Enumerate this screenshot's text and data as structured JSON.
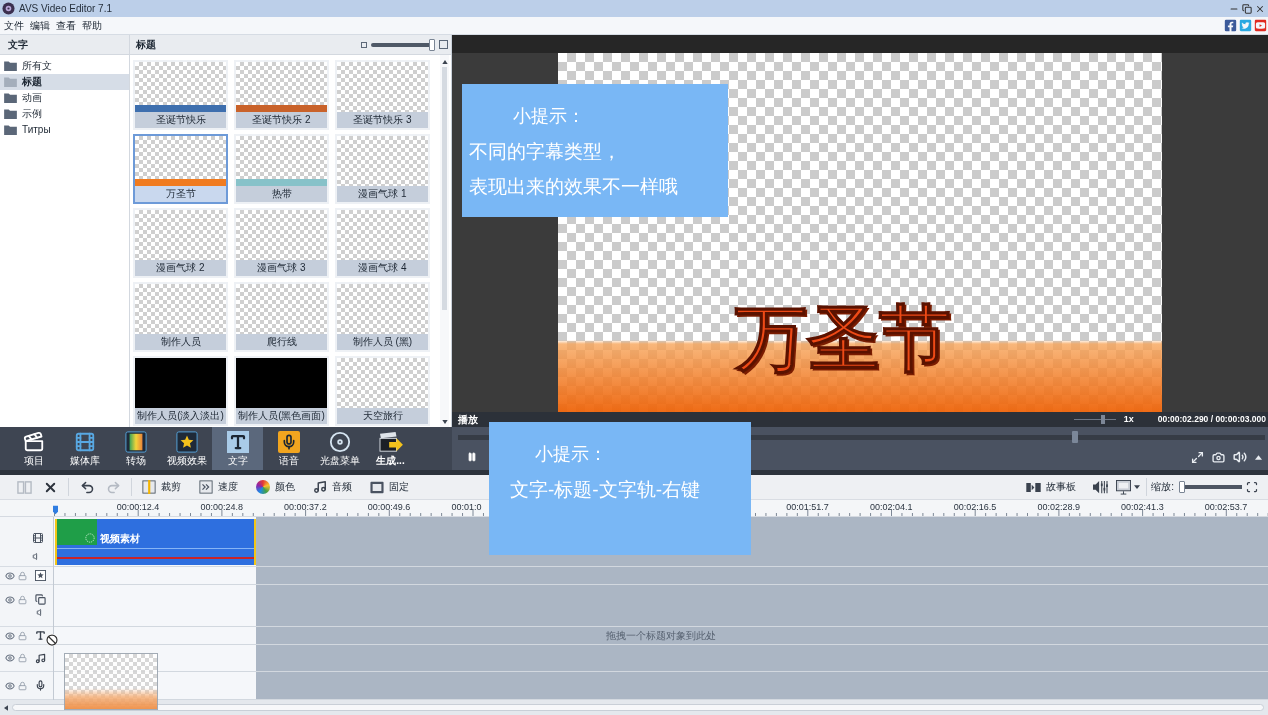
{
  "window": {
    "title": "AVS Video Editor 7.1"
  },
  "menu": [
    "文件",
    "编辑",
    "查看",
    "帮助"
  ],
  "library": {
    "sidebar_title": "文字",
    "folders": [
      {
        "label": "所有文",
        "selected": false
      },
      {
        "label": "标题",
        "selected": true
      },
      {
        "label": "动画",
        "selected": false
      },
      {
        "label": "示例",
        "selected": false
      },
      {
        "label": "Титры",
        "selected": false
      }
    ],
    "grid_title": "标题",
    "thumb_size": {
      "level": 0.95
    },
    "thumbnails": [
      {
        "label": "圣诞节快乐",
        "kind": "band",
        "color": "#3e6fae",
        "selected": false
      },
      {
        "label": "圣诞节快乐 2",
        "kind": "band",
        "color": "#c9622a",
        "selected": false
      },
      {
        "label": "圣诞节快乐 3",
        "kind": "plain",
        "selected": false
      },
      {
        "label": "万圣节",
        "kind": "band",
        "color": "#f07b1f",
        "selected": true
      },
      {
        "label": "热带",
        "kind": "band",
        "color": "#87c2c9",
        "selected": false
      },
      {
        "label": "漫画气球 1",
        "kind": "plain",
        "selected": false
      },
      {
        "label": "漫画气球 2",
        "kind": "plain",
        "selected": false
      },
      {
        "label": "漫画气球 3",
        "kind": "plain",
        "selected": false
      },
      {
        "label": "漫画气球 4",
        "kind": "plain",
        "selected": false
      },
      {
        "label": "制作人员",
        "kind": "plain",
        "selected": false
      },
      {
        "label": "爬行线",
        "kind": "plain",
        "selected": false
      },
      {
        "label": "制作人员 (黑)",
        "kind": "plain",
        "selected": false
      },
      {
        "label": "制作人员(淡入淡出)",
        "kind": "black",
        "selected": false
      },
      {
        "label": "制作人员(黑色画面)",
        "kind": "black",
        "selected": false
      },
      {
        "label": "天空旅行",
        "kind": "plain",
        "selected": false
      }
    ]
  },
  "preview": {
    "title_text": "万圣节",
    "status": "播放",
    "speed": {
      "level": 0.7
    },
    "speed_label": "1x",
    "time": "00:00:02.290 / 00:00:03.000",
    "seek": {
      "level": 0.765
    },
    "playing": true
  },
  "tips": [
    {
      "heading": "小提示：",
      "lines": [
        "不同的字幕类型，",
        "表现出来的效果不一样哦"
      ]
    },
    {
      "heading": "小提示：",
      "lines": [
        "文字-标题-文字轨-右键"
      ]
    }
  ],
  "tools": [
    {
      "kind": "project",
      "label": "项目",
      "selected": false
    },
    {
      "kind": "media",
      "label": "媒体库",
      "selected": false
    },
    {
      "kind": "transition",
      "label": "转场",
      "selected": false
    },
    {
      "kind": "effects",
      "label": "视频效果",
      "selected": false
    },
    {
      "kind": "text",
      "label": "文字",
      "selected": true
    },
    {
      "kind": "voice",
      "label": "语音",
      "selected": false
    },
    {
      "kind": "disc",
      "label": "光盘菜单",
      "selected": false
    },
    {
      "kind": "produce",
      "label": "生成...",
      "selected": false
    }
  ],
  "edit_toolbar": {
    "buttons": [
      {
        "kind": "split",
        "disabled": true
      },
      {
        "kind": "delete",
        "disabled": false
      },
      {
        "kind": "undo",
        "disabled": false
      },
      {
        "kind": "redo",
        "disabled": true
      },
      {
        "kind": "trim",
        "label": "裁剪"
      },
      {
        "kind": "speed",
        "label": "速度"
      },
      {
        "kind": "color",
        "label": "颜色"
      },
      {
        "kind": "audio",
        "label": "音频"
      },
      {
        "kind": "freeze",
        "label": "固定"
      }
    ],
    "storyboard": "故事板",
    "zoom_label": "缩放:",
    "zoom": {
      "level": 0.03
    }
  },
  "timeline": {
    "ruler": [
      "00:00:12.4",
      "00:00:24.8",
      "00:00:37.2",
      "00:00:49.6",
      "00:01:0",
      "00:01:51.7",
      "00:02:04.1",
      "00:02:16.5",
      "00:02:28.9",
      "00:02:41.3",
      "00:02:53.7"
    ],
    "tracks": [
      {
        "kind": "video",
        "clip": "视频素材"
      },
      {
        "kind": "effects"
      },
      {
        "kind": "overlay"
      },
      {
        "kind": "text",
        "hint": "拖拽一个标题对象到此处"
      },
      {
        "kind": "music"
      },
      {
        "kind": "voice"
      }
    ],
    "dragging_title": true
  }
}
